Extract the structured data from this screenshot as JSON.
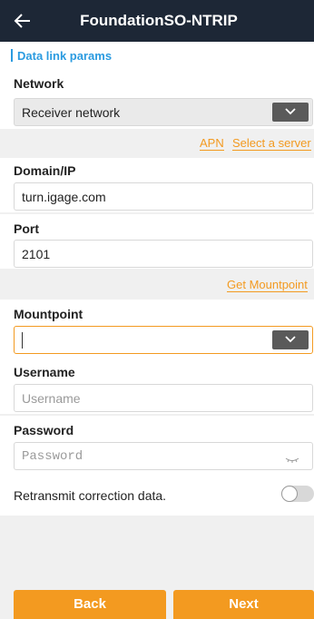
{
  "header": {
    "title": "FoundationSO-NTRIP"
  },
  "section": {
    "title": "Data link params"
  },
  "network": {
    "label": "Network",
    "value": "Receiver network"
  },
  "links": {
    "apn": "APN",
    "select_server": "Select a server",
    "get_mountpoint": "Get Mountpoint"
  },
  "domain": {
    "label": "Domain/IP",
    "value": "turn.igage.com"
  },
  "port": {
    "label": "Port",
    "value": "2101"
  },
  "mountpoint": {
    "label": "Mountpoint",
    "value": ""
  },
  "username": {
    "label": "Username",
    "placeholder": "Username"
  },
  "password": {
    "label": "Password",
    "placeholder": "Password"
  },
  "retransmit": {
    "label": "Retransmit correction data.",
    "enabled": false
  },
  "footer": {
    "back": "Back",
    "next": "Next"
  },
  "colors": {
    "accent": "#f39a20",
    "header": "#1d2736",
    "section": "#2b9be0"
  }
}
